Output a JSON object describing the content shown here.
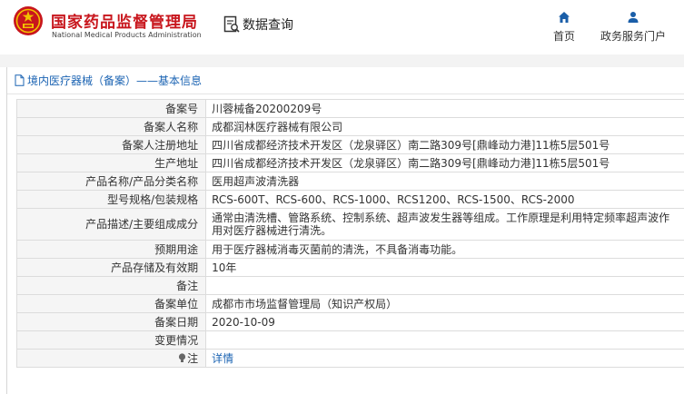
{
  "header": {
    "site_name_cn": "国家药品监督管理局",
    "site_name_en": "National Medical Products Administration",
    "data_query_label": "数据查询",
    "nav": {
      "home_label": "首页",
      "gov_service_label": "政务服务门户"
    }
  },
  "panel": {
    "title": "境内医疗器械（备案）——基本信息"
  },
  "record": {
    "rows": [
      {
        "label": "备案号",
        "value": "川蓉械备20200209号"
      },
      {
        "label": "备案人名称",
        "value": "成都润林医疗器械有限公司"
      },
      {
        "label": "备案人注册地址",
        "value": "四川省成都经济技术开发区（龙泉驿区）南二路309号[鼎峰动力港]11栋5层501号"
      },
      {
        "label": "生产地址",
        "value": "四川省成都经济技术开发区（龙泉驿区）南二路309号[鼎峰动力港]11栋5层501号"
      },
      {
        "label": "产品名称/产品分类名称",
        "value": "医用超声波清洗器"
      },
      {
        "label": "型号规格/包装规格",
        "value": "RCS-600T、RCS-600、RCS-1000、RCS1200、RCS-1500、RCS-2000"
      },
      {
        "label": "产品描述/主要组成成分",
        "value": "通常由清洗槽、管路系统、控制系统、超声波发生器等组成。工作原理是利用特定频率超声波作用对医疗器械进行清洗。"
      },
      {
        "label": "预期用途",
        "value": "用于医疗器械消毒灭菌前的清洗，不具备消毒功能。"
      },
      {
        "label": "产品存储及有效期",
        "value": "10年"
      },
      {
        "label": "备注",
        "value": ""
      },
      {
        "label": "备案单位",
        "value": "成都市市场监督管理局（知识产权局）"
      },
      {
        "label": "备案日期",
        "value": "2020-10-09"
      },
      {
        "label": "变更情况",
        "value": ""
      },
      {
        "label": "注",
        "value": "详情"
      }
    ]
  },
  "colors": {
    "brand_red": "#c8161d",
    "link_blue": "#1c64b3",
    "nav_blue": "#1a5ea8"
  }
}
